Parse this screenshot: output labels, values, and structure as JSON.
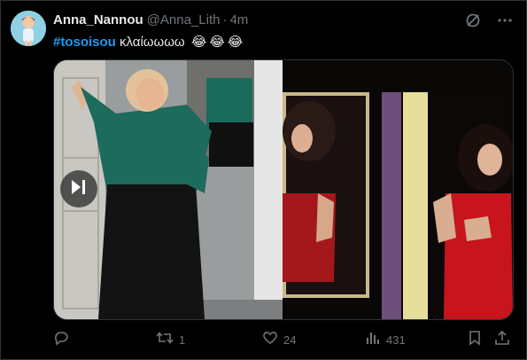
{
  "author": {
    "display_name": "Anna_Nannou",
    "handle": "@Anna_Lith",
    "separator": "·",
    "time": "4m"
  },
  "tweet": {
    "hashtag": "#tosoisou",
    "text": "κλαίωωωω",
    "emojis": [
      "😂",
      "😂",
      "😂"
    ]
  },
  "media": {
    "play_icon": "play-pause-icon"
  },
  "actions": {
    "reply_icon": "reply-icon",
    "retweet_count": "1",
    "like_count": "24",
    "view_count": "431"
  },
  "colors": {
    "background": "#000000",
    "text": "#e7e9ea",
    "muted": "#71767b",
    "accent": "#1d9bf0",
    "border": "#2f3336"
  }
}
